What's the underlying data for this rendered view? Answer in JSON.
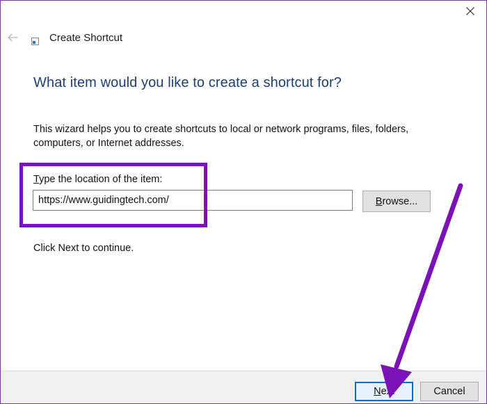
{
  "window": {
    "title": "Create Shortcut"
  },
  "wizard": {
    "heading": "What item would you like to create a shortcut for?",
    "description": "This wizard helps you to create shortcuts to local or network programs, files, folders, computers, or Internet addresses.",
    "field_label_first": "T",
    "field_label_rest": "ype the location of the item:",
    "location_value": "https://www.guidingtech.com/",
    "browse_first": "B",
    "browse_rest": "rowse...",
    "continue_text": "Click Next to continue."
  },
  "footer": {
    "next_first": "N",
    "next_rest": "ext",
    "cancel_label": "Cancel"
  },
  "icons": {
    "close": "close-icon",
    "back": "back-arrow-icon",
    "app": "shortcut-app-icon"
  },
  "colors": {
    "heading": "#1c3f74",
    "highlight": "#7a12b8",
    "annotation_arrow": "#7a12b8",
    "default_button_border": "#0a6bd1"
  }
}
